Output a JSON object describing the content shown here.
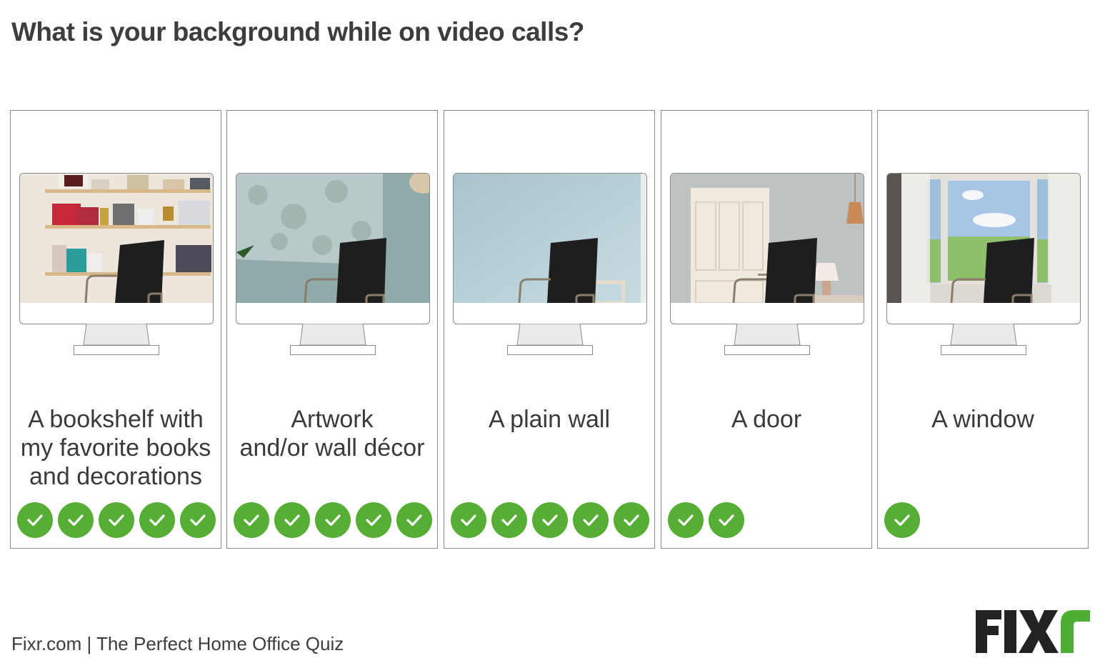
{
  "title": "What is your background while on video calls?",
  "options": [
    {
      "label_lines": [
        "A bookshelf with",
        "my favorite books",
        "and decorations"
      ],
      "votes": 5,
      "scene": "bookshelf"
    },
    {
      "label_lines": [
        "Artwork",
        "and/or wall décor"
      ],
      "votes": 5,
      "scene": "artwork"
    },
    {
      "label_lines": [
        "A plain wall"
      ],
      "votes": 5,
      "scene": "plain-wall"
    },
    {
      "label_lines": [
        "A door"
      ],
      "votes": 2,
      "scene": "door"
    },
    {
      "label_lines": [
        "A window"
      ],
      "votes": 1,
      "scene": "window"
    }
  ],
  "footer": {
    "source": "Fixr.com | The Perfect Home Office Quiz",
    "logo_text_dark": "FIX",
    "logo_text_accent": "r"
  },
  "colors": {
    "check_green": "#56ae34",
    "logo_dark": "#222222",
    "logo_green": "#4cae34",
    "text": "#3a3a3a"
  },
  "chart_data": {
    "type": "table",
    "title": "What is your background while on video calls?",
    "categories": [
      "A bookshelf with my favorite books and decorations",
      "Artwork and/or wall décor",
      "A plain wall",
      "A door",
      "A window"
    ],
    "values": [
      5,
      5,
      5,
      2,
      1
    ],
    "unit": "check marks"
  }
}
